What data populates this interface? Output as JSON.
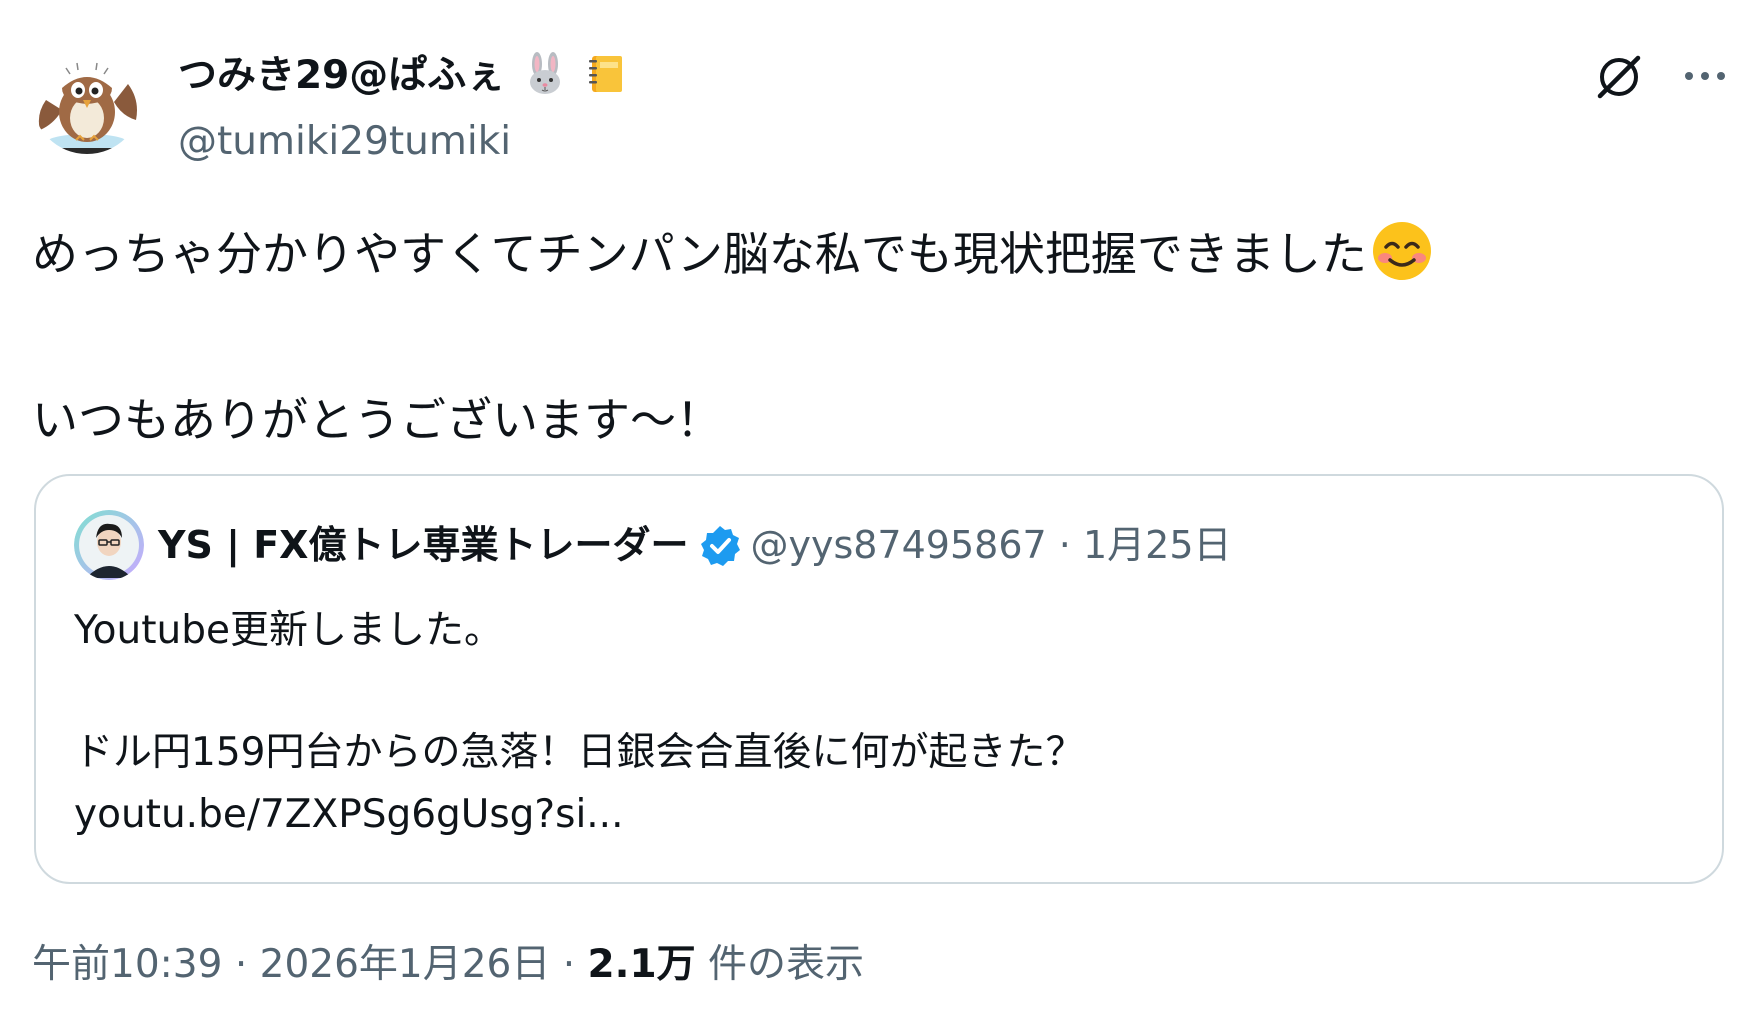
{
  "author": {
    "display_name": "つみき29@ぱふぇ",
    "name_emojis": [
      "rabbit-face",
      "notebook"
    ],
    "handle": "@tumiki29tumiki"
  },
  "actions": {
    "grok_icon": "grok-icon",
    "more_icon": "more-icon"
  },
  "tweet": {
    "line1": "めっちゃ分かりやすくてチンパン脳な私でも現状把握できました",
    "line1_emoji": "smiling-face-with-smiling-eyes",
    "line2": "いつもありがとうございます～！"
  },
  "quote": {
    "name": "YS | FX億トレ専業トレーダー",
    "verified_icon": "verified-badge-icon",
    "handle": "@yys87495867",
    "separator": "·",
    "date": "1月25日",
    "text_line1": "Youtube更新しました。",
    "text_line2": "ドル円159円台からの急落！日銀会合直後に何が起きた？",
    "link": "youtu.be/7ZXPSg6gUsg?si..."
  },
  "meta": {
    "time": "午前10:39",
    "separator": "·",
    "date": "2026年1月26日",
    "views_count": "2.1万",
    "views_label": "件の表示"
  },
  "colors": {
    "text": "#0f1419",
    "secondary": "#536471",
    "border": "#cfd9de",
    "verified": "#1d9bf0"
  }
}
